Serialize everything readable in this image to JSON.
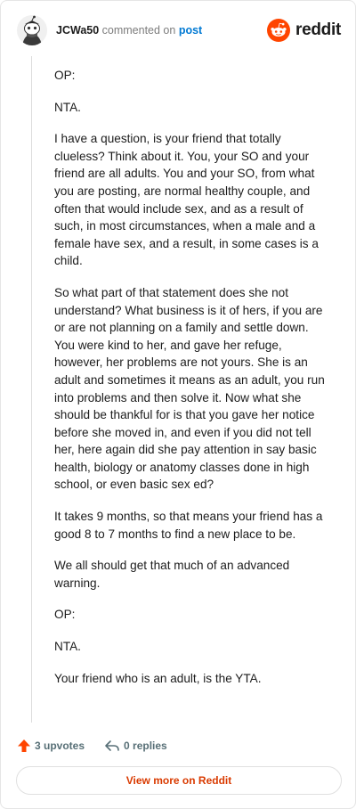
{
  "header": {
    "username": "JCWa50",
    "action_text": "commented on",
    "link_text": "post",
    "logo_text": "reddit",
    "brand_color": "#ff4500"
  },
  "comment": {
    "paragraphs": [
      "OP:",
      "NTA.",
      "I have a question, is your friend that totally clueless? Think about it. You, your SO and your friend are all adults. You and your SO, from what you are posting, are normal healthy couple, and often that would include sex, and as a result of such, in most circumstances, when a male and a female have sex, and a result, in some cases is a child.",
      "So what part of that statement does she not understand? What business is it of hers, if you are or are not planning on a family and settle down. You were kind to her, and gave her refuge, however, her problems are not yours. She is an adult and sometimes it means as an adult, you run into problems and then solve it. Now what she should be thankful for is that you gave her notice before she moved in, and even if you did not tell her, here again did she pay attention in say basic health, biology or anatomy classes done in high school, or even basic sex ed?",
      "It takes 9 months, so that means your friend has a good 8 to 7 months to find a new place to be.",
      "We all should get that much of an advanced warning.",
      "OP:",
      "NTA.",
      "Your friend who is an adult, is the YTA."
    ]
  },
  "footer": {
    "upvotes": "3 upvotes",
    "replies": "0 replies",
    "upvote_icon": "upvote-arrow-icon",
    "reply_icon": "reply-arrow-icon"
  },
  "view_more": {
    "label": "View more on Reddit",
    "color": "#d93a00"
  }
}
